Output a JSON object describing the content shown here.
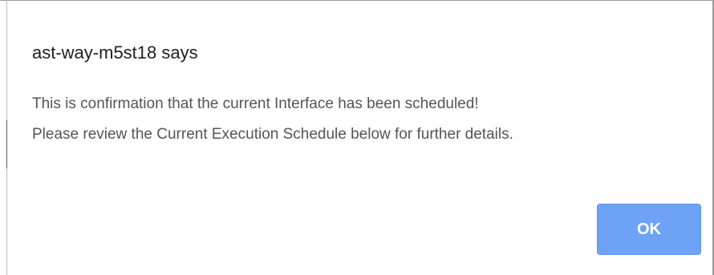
{
  "dialog": {
    "title": "ast-way-m5st18 says",
    "message_lines": [
      "This is confirmation that the current Interface has been scheduled!",
      "Please review the Current Execution Schedule below for further details."
    ],
    "ok_label": "OK",
    "button_color": "#6ea2f7"
  }
}
